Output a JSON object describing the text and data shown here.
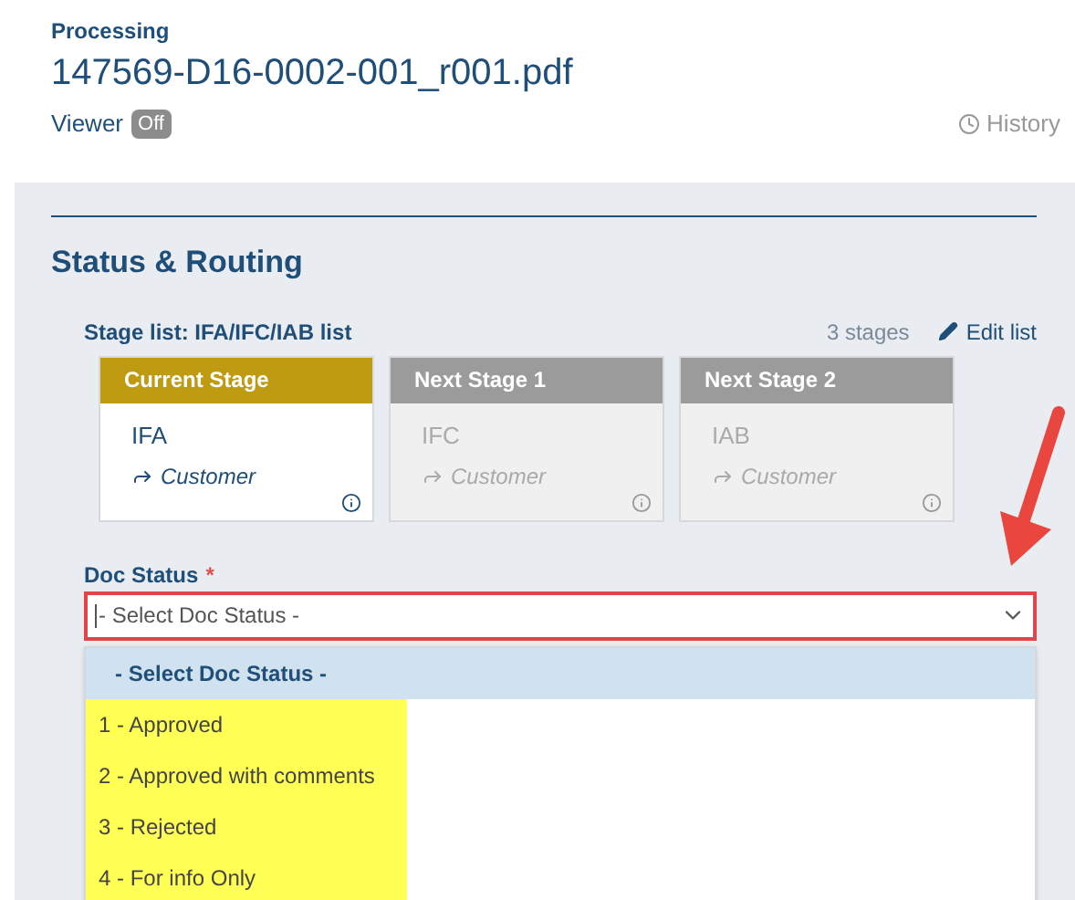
{
  "header": {
    "eyebrow": "Processing",
    "file_name": "147569-D16-0002-001_r001.pdf",
    "viewer_label": "Viewer",
    "viewer_toggle": {
      "label": "Off",
      "on": false
    },
    "history_link": "History"
  },
  "section": {
    "title": "Status & Routing",
    "stage_list_label": "Stage list: IFA/IFC/IAB list",
    "stage_count": "3 stages",
    "edit_link": "Edit list",
    "stages": [
      {
        "heading": "Current Stage",
        "code": "IFA",
        "recipient": "Customer",
        "current": true
      },
      {
        "heading": "Next Stage 1",
        "code": "IFC",
        "recipient": "Customer",
        "current": false
      },
      {
        "heading": "Next Stage 2",
        "code": "IAB",
        "recipient": "Customer",
        "current": false
      }
    ],
    "doc_status": {
      "label": "Doc Status",
      "required_mark": "*",
      "placeholder": "- Select Doc Status -",
      "expanded": true,
      "options": [
        {
          "label": "- Select Doc Status -",
          "selected": true,
          "highlighted": false
        },
        {
          "label": "1 - Approved",
          "selected": false,
          "highlighted": true
        },
        {
          "label": "2 - Approved with comments",
          "selected": false,
          "highlighted": true
        },
        {
          "label": "3 - Rejected",
          "selected": false,
          "highlighted": true
        },
        {
          "label": "4 - For info Only",
          "selected": false,
          "highlighted": true
        }
      ]
    }
  }
}
